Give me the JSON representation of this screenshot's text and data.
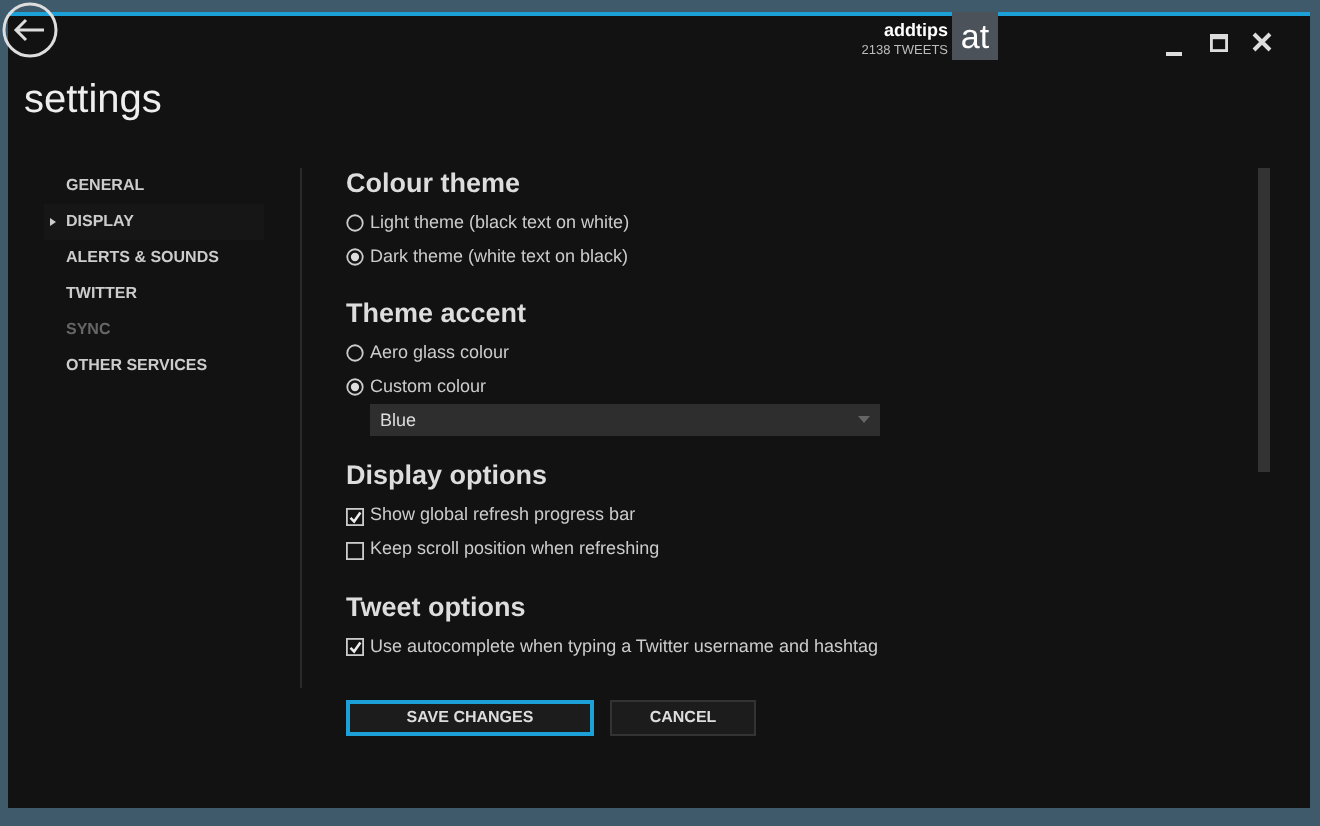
{
  "header": {
    "account_name": "addtips",
    "tweet_count": "2138 TWEETS",
    "avatar_text": "at"
  },
  "page_title": "settings",
  "sidebar": {
    "items": [
      {
        "label": "GENERAL",
        "selected": false,
        "disabled": false
      },
      {
        "label": "DISPLAY",
        "selected": true,
        "disabled": false
      },
      {
        "label": "ALERTS & SOUNDS",
        "selected": false,
        "disabled": false
      },
      {
        "label": "TWITTER",
        "selected": false,
        "disabled": false
      },
      {
        "label": "SYNC",
        "selected": false,
        "disabled": true
      },
      {
        "label": "OTHER SERVICES",
        "selected": false,
        "disabled": false
      }
    ]
  },
  "sections": [
    {
      "title": "Colour theme",
      "options": [
        {
          "kind": "radio",
          "label": "Light theme (black text on white)",
          "checked": false
        },
        {
          "kind": "radio",
          "label": "Dark theme (white text on black)",
          "checked": true
        }
      ]
    },
    {
      "title": "Theme accent",
      "options": [
        {
          "kind": "radio",
          "label": "Aero glass colour",
          "checked": false
        },
        {
          "kind": "radio",
          "label": "Custom colour",
          "checked": true
        },
        {
          "kind": "dropdown",
          "value": "Blue"
        }
      ]
    },
    {
      "title": "Display options",
      "options": [
        {
          "kind": "checkbox",
          "label": "Show global refresh progress bar",
          "checked": true
        },
        {
          "kind": "checkbox",
          "label": "Keep scroll position when refreshing",
          "checked": false
        }
      ]
    },
    {
      "title": "Tweet options",
      "options": [
        {
          "kind": "checkbox",
          "label": "Use autocomplete when typing a Twitter username and hashtag",
          "checked": true
        }
      ]
    }
  ],
  "buttons": [
    {
      "label": "SAVE CHANGES",
      "kind": "primary"
    },
    {
      "label": "CANCEL",
      "kind": "secondary"
    }
  ]
}
